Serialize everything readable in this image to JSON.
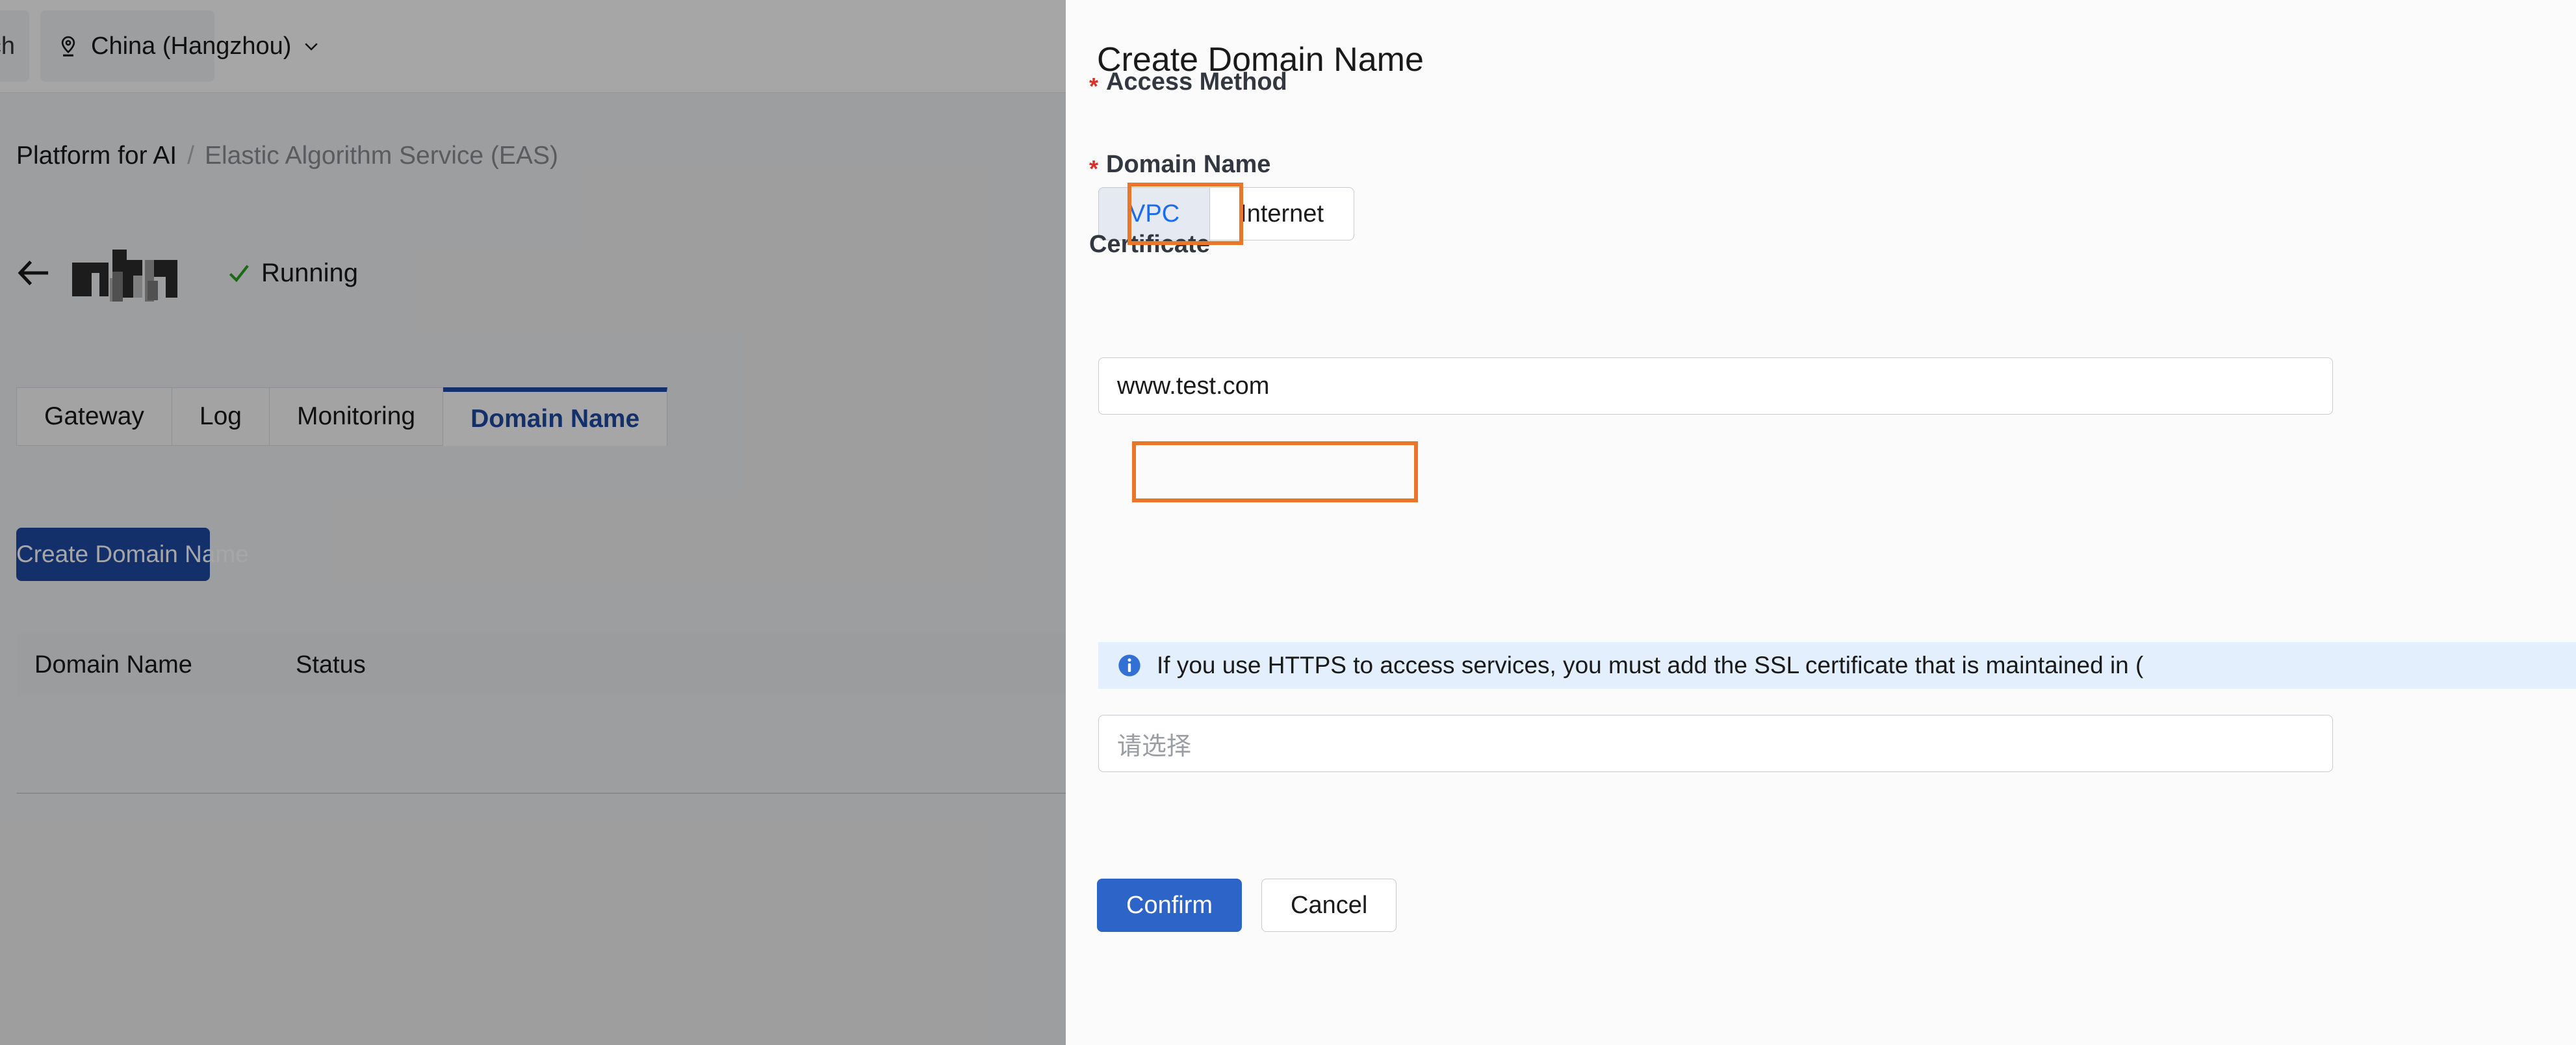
{
  "background_page": {
    "topbar": {
      "search_partial": "ch",
      "region": {
        "label": "China (Hangzhou)",
        "pin_icon": "location-pin-icon",
        "chevron_icon": "chevron-down-icon"
      }
    },
    "breadcrumb": {
      "root": "Platform for AI",
      "separator": "/",
      "current": "Elastic Algorithm Service (EAS)"
    },
    "title_row": {
      "back_icon": "back-arrow-icon",
      "service_name_redacted": "",
      "status_icon": "check-icon",
      "status_text": "Running",
      "status_color": "#2aa121"
    },
    "tabs": [
      {
        "label": "Gateway",
        "active": false
      },
      {
        "label": "Log",
        "active": false
      },
      {
        "label": "Monitoring",
        "active": false
      },
      {
        "label": "Domain Name",
        "active": true
      }
    ],
    "create_button": "Create Domain Name",
    "table": {
      "columns": [
        "Domain Name",
        "Status"
      ],
      "rows": []
    },
    "accent_color": "#1f4ba5"
  },
  "drawer": {
    "title": "Create Domain Name",
    "access_method": {
      "label": "Access Method",
      "required": true,
      "required_marker": "*",
      "options": [
        "VPC",
        "Internet"
      ],
      "selected": "VPC"
    },
    "domain_name": {
      "label": "Domain Name",
      "required": true,
      "required_marker": "*",
      "value": "www.test.com",
      "placeholder": ""
    },
    "certificate": {
      "label": "Certificate",
      "required": false,
      "info_icon": "info-circle-icon",
      "info_text": "If you use HTTPS to access services, you must add the SSL certificate that is maintained in (",
      "select_placeholder": "请选择"
    },
    "buttons": {
      "confirm": "Confirm",
      "cancel": "Cancel"
    },
    "primary_color": "#2d64c8",
    "info_bg_color": "#e3effc"
  },
  "annotations": {
    "highlight_color": "#e8772a",
    "boxes": [
      "vpc-option",
      "domain-name-input"
    ]
  }
}
